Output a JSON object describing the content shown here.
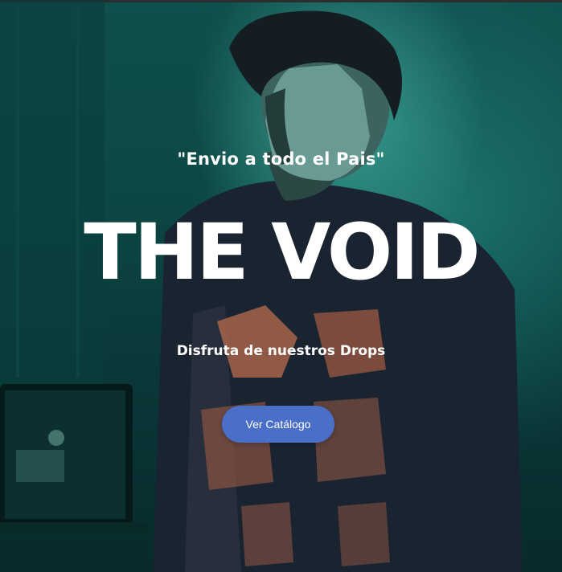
{
  "hero": {
    "tagline": "\"Envio a todo el Pais\"",
    "title": "THE VOID",
    "subtitle": "Disfruta de nuestros Drops",
    "cta_label": "Ver Catálogo"
  },
  "colors": {
    "background_teal": "#0d4744",
    "cta_blue": "#4a6fc9",
    "text": "#ffffff"
  }
}
